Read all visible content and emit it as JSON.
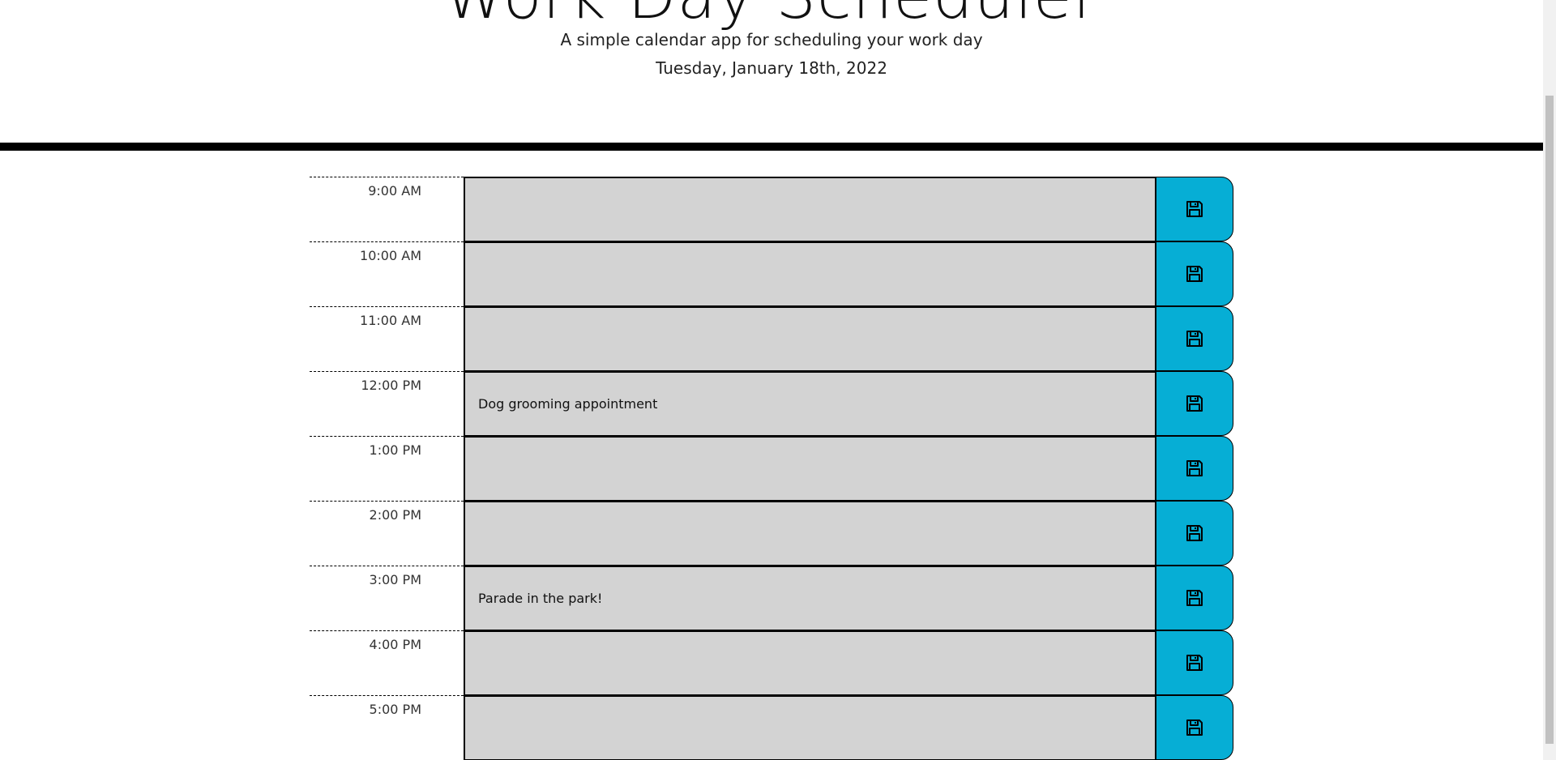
{
  "header": {
    "title": "Work Day Scheduler",
    "lead": "A simple calendar app for scheduling your work day",
    "current_day": "Tuesday, January 18th, 2022"
  },
  "timeblocks": [
    {
      "hour": "9:00 AM",
      "text": ""
    },
    {
      "hour": "10:00 AM",
      "text": ""
    },
    {
      "hour": "11:00 AM",
      "text": ""
    },
    {
      "hour": "12:00 PM",
      "text": "Dog grooming appointment"
    },
    {
      "hour": "1:00 PM",
      "text": ""
    },
    {
      "hour": "2:00 PM",
      "text": ""
    },
    {
      "hour": "3:00 PM",
      "text": "Parade in the park!"
    },
    {
      "hour": "4:00 PM",
      "text": ""
    },
    {
      "hour": "5:00 PM",
      "text": ""
    }
  ],
  "colors": {
    "past": "#d3d3d3",
    "save_button": "#06aed5",
    "header_border": "#000000"
  },
  "icons": {
    "save": "floppy-disk-icon"
  }
}
